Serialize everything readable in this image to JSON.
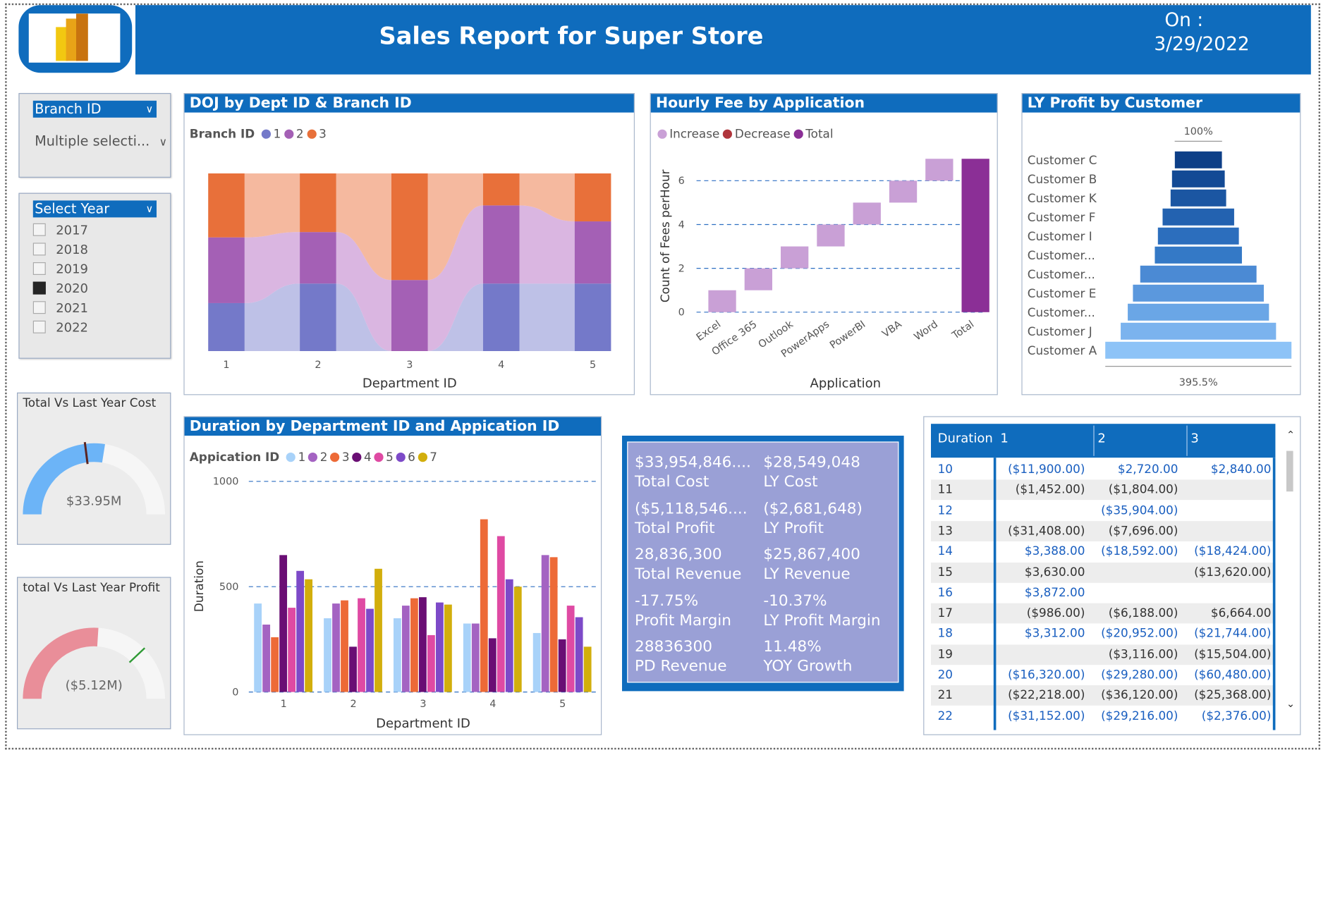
{
  "header": {
    "title": "Sales Report for Super Store",
    "on_label": "On :",
    "date": "3/29/2022"
  },
  "slicers": {
    "branch": {
      "title": "Branch ID",
      "value": "Multiple selecti..."
    },
    "year": {
      "title": "Select Year",
      "items": [
        {
          "label": "2017",
          "checked": false
        },
        {
          "label": "2018",
          "checked": false
        },
        {
          "label": "2019",
          "checked": false
        },
        {
          "label": "2020",
          "checked": true
        },
        {
          "label": "2021",
          "checked": false
        },
        {
          "label": "2022",
          "checked": false
        }
      ]
    }
  },
  "gauges": {
    "cost": {
      "title": "Total Vs Last Year Cost",
      "value": "$33.95M",
      "fill_fraction": 0.55,
      "color": "#6cb4f7"
    },
    "profit": {
      "title": "total Vs Last Year Profit",
      "value": "($5.12M)",
      "fill_fraction": 0.52,
      "color": "#e98e99"
    }
  },
  "panels": {
    "doj": {
      "title": "DOJ by Dept ID & Branch ID",
      "legend_title": "Branch ID",
      "xlabel": "Department ID"
    },
    "hourly": {
      "title": "Hourly Fee by Application",
      "xlabel": "Application",
      "ylabel": "Count of Fees perHour"
    },
    "ly_profit": {
      "title": "LY Profit by Customer",
      "top_label": "100%",
      "bottom_label": "395.5%"
    },
    "duration": {
      "title": "Duration by Department ID and Appication ID",
      "legend_title": "Appication ID",
      "xlabel": "Department ID",
      "ylabel": "Duration"
    }
  },
  "kpis": [
    {
      "value": "$33,954,846....",
      "label": "Total Cost"
    },
    {
      "value": "$28,549,048",
      "label": "LY Cost"
    },
    {
      "value": "($5,118,546....",
      "label": "Total Profit"
    },
    {
      "value": "($2,681,648)",
      "label": "LY Profit"
    },
    {
      "value": "28,836,300",
      "label": "Total Revenue"
    },
    {
      "value": "$25,867,400",
      "label": "LY Revenue"
    },
    {
      "value": "-17.75%",
      "label": "Profit Margin"
    },
    {
      "value": "-10.37%",
      "label": "LY Profit Margin"
    },
    {
      "value": "28836300",
      "label": "PD Revenue"
    },
    {
      "value": "11.48%",
      "label": "YOY Growth"
    }
  ],
  "table": {
    "headers": [
      "Duration",
      "1",
      "2",
      "3"
    ],
    "rows": [
      [
        "10",
        "($11,900.00)",
        "$2,720.00",
        "$2,840.00"
      ],
      [
        "11",
        "($1,452.00)",
        "($1,804.00)",
        ""
      ],
      [
        "12",
        "",
        "($35,904.00)",
        ""
      ],
      [
        "13",
        "($31,408.00)",
        "($7,696.00)",
        ""
      ],
      [
        "14",
        "$3,388.00",
        "($18,592.00)",
        "($18,424.00)"
      ],
      [
        "15",
        "$3,630.00",
        "",
        "($13,620.00)"
      ],
      [
        "16",
        "$3,872.00",
        "",
        ""
      ],
      [
        "17",
        "($986.00)",
        "($6,188.00)",
        "$6,664.00"
      ],
      [
        "18",
        "$3,312.00",
        "($20,952.00)",
        "($21,744.00)"
      ],
      [
        "19",
        "",
        "($3,116.00)",
        "($15,504.00)"
      ],
      [
        "20",
        "($16,320.00)",
        "($29,280.00)",
        "($60,480.00)"
      ],
      [
        "21",
        "($22,218.00)",
        "($36,120.00)",
        "($25,368.00)"
      ],
      [
        "22",
        "($31,152.00)",
        "($29,216.00)",
        "($2,376.00)"
      ]
    ],
    "blue_rows": [
      0,
      2,
      4,
      6,
      8,
      10,
      12
    ],
    "scroll_up": "⌃",
    "scroll_down": "⌄"
  },
  "chart_data": [
    {
      "type": "bar",
      "title": "DOJ by Dept ID & Branch ID",
      "xlabel": "Department ID",
      "categories": [
        "1",
        "2",
        "3",
        "4",
        "5"
      ],
      "series": [
        {
          "name": "1",
          "color": "#7479c9",
          "values": [
            0.27,
            0.38,
            0.0,
            0.38,
            0.38
          ]
        },
        {
          "name": "2",
          "color": "#a460b5",
          "values": [
            0.37,
            0.29,
            0.4,
            0.44,
            0.35
          ]
        },
        {
          "name": "3",
          "color": "#e8703a",
          "values": [
            0.36,
            0.33,
            0.6,
            0.18,
            0.27
          ]
        }
      ]
    },
    {
      "type": "bar",
      "title": "Hourly Fee by Application",
      "xlabel": "Application",
      "ylabel": "Count of Fees perHour",
      "categories": [
        "Excel",
        "Office 365",
        "Outlook",
        "PowerApps",
        "PowerBI",
        "VBA",
        "Word",
        "Total"
      ],
      "series": [
        {
          "name": "Fees",
          "values": [
            1,
            1,
            1,
            1,
            1,
            1,
            1,
            7
          ]
        }
      ],
      "legend": [
        "Increase",
        "Decrease",
        "Total"
      ],
      "legend_colors": [
        "#c9a0d6",
        "#b0353c",
        "#8b2f96"
      ],
      "yticks": [
        0,
        2,
        4,
        6
      ],
      "ylim": [
        0,
        7.5
      ]
    },
    {
      "type": "bar",
      "title": "LY Profit by Customer",
      "categories": [
        "Customer C",
        "Customer B",
        "Customer K",
        "Customer F",
        "Customer I",
        "Customer...",
        "Customer...",
        "Customer E",
        "Customer...",
        "Customer J",
        "Customer A"
      ],
      "values": [
        100,
        112,
        118,
        152,
        172,
        185,
        247,
        278,
        300,
        330,
        395.5
      ],
      "colors": [
        "#0d3f87",
        "#134a95",
        "#1b56a2",
        "#2362b0",
        "#2c6ebd",
        "#3479c6",
        "#4b8ad4",
        "#5b98dd",
        "#6aa6e6",
        "#7bb3ee",
        "#8dc3f7"
      ]
    },
    {
      "type": "bar",
      "title": "Duration by Department ID and Appication ID",
      "xlabel": "Department ID",
      "ylabel": "Duration",
      "categories": [
        "1",
        "2",
        "3",
        "4",
        "5"
      ],
      "yticks": [
        0,
        500,
        1000
      ],
      "ylim": [
        0,
        1000
      ],
      "series": [
        {
          "name": "1",
          "color": "#a8d2f9",
          "values": [
            420,
            350,
            350,
            325,
            280
          ]
        },
        {
          "name": "2",
          "color": "#a463c2",
          "values": [
            320,
            420,
            410,
            325,
            650
          ]
        },
        {
          "name": "3",
          "color": "#ed6a37",
          "values": [
            260,
            435,
            445,
            820,
            640
          ]
        },
        {
          "name": "4",
          "color": "#6a0e74",
          "values": [
            650,
            215,
            450,
            255,
            250
          ]
        },
        {
          "name": "5",
          "color": "#df4aa3",
          "values": [
            400,
            445,
            270,
            740,
            410
          ]
        },
        {
          "name": "6",
          "color": "#7d4ac8",
          "values": [
            575,
            395,
            425,
            535,
            355
          ]
        },
        {
          "name": "7",
          "color": "#d2ae0c",
          "values": [
            535,
            585,
            415,
            500,
            215
          ]
        }
      ]
    }
  ]
}
